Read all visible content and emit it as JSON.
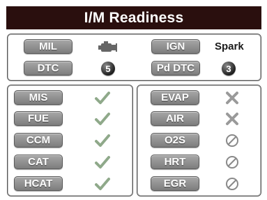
{
  "header": {
    "title": "I/M Readiness"
  },
  "top": {
    "row1": {
      "left_label": "MIL",
      "left_icon": "engine-icon",
      "right_label": "IGN",
      "right_value": "Spark"
    },
    "row2": {
      "left_label": "DTC",
      "left_value": "5",
      "right_label": "Pd DTC",
      "right_value": "3"
    }
  },
  "monitors_left": [
    {
      "label": "MIS",
      "status": "complete"
    },
    {
      "label": "FUE",
      "status": "complete"
    },
    {
      "label": "CCM",
      "status": "complete"
    },
    {
      "label": "CAT",
      "status": "complete"
    },
    {
      "label": "HCAT",
      "status": "complete"
    }
  ],
  "monitors_right": [
    {
      "label": "EVAP",
      "status": "incomplete"
    },
    {
      "label": "AIR",
      "status": "incomplete"
    },
    {
      "label": "O2S",
      "status": "not-supported"
    },
    {
      "label": "HRT",
      "status": "not-supported"
    },
    {
      "label": "EGR",
      "status": "not-supported"
    }
  ],
  "colors": {
    "header_bg": "#2a0f0e",
    "button_gray": "#8f8f8f",
    "check_green": "#8fa98a",
    "x_gray": "#9a9a9a"
  }
}
